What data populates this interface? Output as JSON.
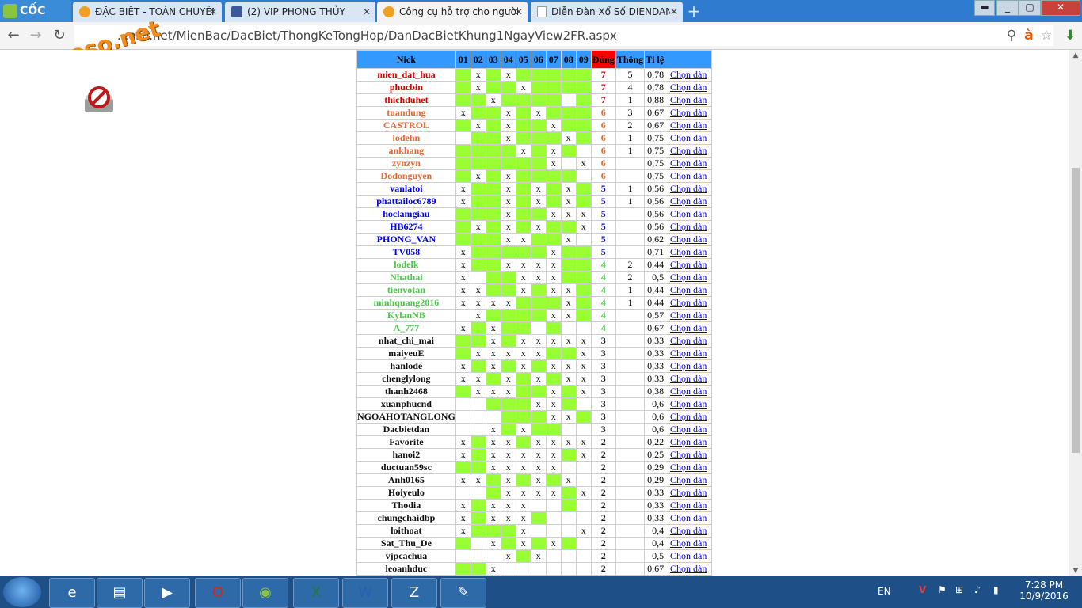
{
  "browser": {
    "logo": "CỐC CỐC",
    "tabs": [
      {
        "title": "ĐẶC BIỆT - TOÀN CHUYÊN",
        "icon": "xs-icon"
      },
      {
        "title": "(2) VIP PHONG THỦY",
        "icon": "facebook-icon"
      },
      {
        "title": "Công cụ hỗ trợ cho người",
        "icon": "xs-icon",
        "active": true
      },
      {
        "title": "Diễn Đàn Xổ Số DIENDAN",
        "icon": "page-icon"
      }
    ],
    "url": "...oso.net/MienBac/DacBiet/ThongKeTongHop/DanDacBietKhung1NgayView2FR.aspx",
    "watermark": "webxoso.net"
  },
  "table": {
    "headers": [
      "Nick",
      "01",
      "02",
      "03",
      "04",
      "05",
      "06",
      "07",
      "08",
      "09",
      "Đúng",
      "Thông",
      "Tỉ lệ",
      ""
    ],
    "link_label": "Chọn dàn",
    "rows": [
      {
        "nick": "mien_dat_hua",
        "marks": "g,x,g,x,g,g,g,g,g",
        "correct": "7",
        "streak": "5",
        "ratio": "0,78"
      },
      {
        "nick": "phucbin",
        "marks": "g,x,g,g,x,g,g,g,g",
        "correct": "7",
        "streak": "4",
        "ratio": "0,78"
      },
      {
        "nick": "thichduhet",
        "marks": "g,g,x,g,g,g,g,_,g",
        "correct": "7",
        "streak": "1",
        "ratio": "0,88"
      },
      {
        "nick": "tuandung",
        "marks": "x,g,g,x,g,x,g,g,g",
        "correct": "6",
        "streak": "3",
        "ratio": "0,67"
      },
      {
        "nick": "CASTROL",
        "marks": "g,x,g,x,g,g,x,g,g",
        "correct": "6",
        "streak": "2",
        "ratio": "0,67"
      },
      {
        "nick": "lodehn",
        "marks": "_,g,g,x,g,g,g,x,g",
        "correct": "6",
        "streak": "1",
        "ratio": "0,75"
      },
      {
        "nick": "ankhang",
        "marks": "g,g,g,g,x,g,x,g,_",
        "correct": "6",
        "streak": "1",
        "ratio": "0,75"
      },
      {
        "nick": "zynzyn",
        "marks": "g,g,g,g,g,g,x,_,x",
        "correct": "6",
        "streak": "",
        "ratio": "0,75"
      },
      {
        "nick": "Dodonguyen",
        "marks": "g,x,g,x,g,g,g,g,_",
        "correct": "6",
        "streak": "",
        "ratio": "0,75"
      },
      {
        "nick": "vanlatoi",
        "marks": "x,g,g,x,g,x,g,x,g",
        "correct": "5",
        "streak": "1",
        "ratio": "0,56"
      },
      {
        "nick": "phattailoc6789",
        "marks": "x,g,g,x,g,x,g,x,g",
        "correct": "5",
        "streak": "1",
        "ratio": "0,56"
      },
      {
        "nick": "hoclamgiau",
        "marks": "g,g,g,x,g,g,x,x,x",
        "correct": "5",
        "streak": "",
        "ratio": "0,56"
      },
      {
        "nick": "HB6274",
        "marks": "g,x,g,x,g,x,g,g,x",
        "correct": "5",
        "streak": "",
        "ratio": "0,56"
      },
      {
        "nick": "PHONG_VAN",
        "marks": "g,g,g,x,x,g,g,x,_",
        "correct": "5",
        "streak": "",
        "ratio": "0,62"
      },
      {
        "nick": "TV058",
        "marks": "x,g,g,g,g,g,x,g,g",
        "correct": "5",
        "streak": "",
        "ratio": "0,71"
      },
      {
        "nick": "lodelk",
        "marks": "x,g,g,x,x,x,x,g,g",
        "correct": "4",
        "streak": "2",
        "ratio": "0,44"
      },
      {
        "nick": "Nhathai",
        "marks": "x,_,g,g,x,x,x,g,g",
        "correct": "4",
        "streak": "2",
        "ratio": "0,5"
      },
      {
        "nick": "tienvotan",
        "marks": "x,x,g,g,x,g,x,x,g",
        "correct": "4",
        "streak": "1",
        "ratio": "0,44"
      },
      {
        "nick": "minhquang2016",
        "marks": "x,x,x,x,g,g,g,x,g",
        "correct": "4",
        "streak": "1",
        "ratio": "0,44"
      },
      {
        "nick": "KylanNB",
        "marks": "_,x,g,g,g,g,x,x,g",
        "correct": "4",
        "streak": "",
        "ratio": "0,57"
      },
      {
        "nick": "A_777",
        "marks": "x,g,x,g,g,_,g,_,_",
        "correct": "4",
        "streak": "",
        "ratio": "0,67"
      },
      {
        "nick": "nhat_chi_mai",
        "marks": "g,g,x,g,x,x,x,x,x",
        "correct": "3",
        "streak": "",
        "ratio": "0,33"
      },
      {
        "nick": "maiyeuE",
        "marks": "g,x,x,x,x,x,g,g,x",
        "correct": "3",
        "streak": "",
        "ratio": "0,33"
      },
      {
        "nick": "hanlode",
        "marks": "x,g,x,g,x,g,x,x,x",
        "correct": "3",
        "streak": "",
        "ratio": "0,33"
      },
      {
        "nick": "chenglylong",
        "marks": "x,x,g,x,g,x,g,x,x",
        "correct": "3",
        "streak": "",
        "ratio": "0,33"
      },
      {
        "nick": "thanh2468",
        "marks": "g,x,x,x,g,g,x,g,x",
        "correct": "3",
        "streak": "",
        "ratio": "0,38"
      },
      {
        "nick": "xuanphucnd",
        "marks": "_,_,g,g,g,x,x,g,_",
        "correct": "3",
        "streak": "",
        "ratio": "0,6"
      },
      {
        "nick": "NGOAHOTANGLONG",
        "marks": "_,_,_,g,g,g,x,x,g",
        "correct": "3",
        "streak": "",
        "ratio": "0,6"
      },
      {
        "nick": "Dacbietdan",
        "marks": "_,_,x,g,x,g,g,_,_",
        "correct": "3",
        "streak": "",
        "ratio": "0,6"
      },
      {
        "nick": "Favorite",
        "marks": "x,g,x,x,g,x,x,x,x",
        "correct": "2",
        "streak": "",
        "ratio": "0,22"
      },
      {
        "nick": "hanoi2",
        "marks": "x,g,x,x,x,x,x,g,x",
        "correct": "2",
        "streak": "",
        "ratio": "0,25"
      },
      {
        "nick": "ductuan59sc",
        "marks": "g,g,x,x,x,x,x,_,_",
        "correct": "2",
        "streak": "",
        "ratio": "0,29"
      },
      {
        "nick": "Anh0165",
        "marks": "x,x,g,x,g,x,g,x,_",
        "correct": "2",
        "streak": "",
        "ratio": "0,29"
      },
      {
        "nick": "Hoiyeulo",
        "marks": "_,_,g,x,x,x,x,g,x",
        "correct": "2",
        "streak": "",
        "ratio": "0,33"
      },
      {
        "nick": "Thodia",
        "marks": "x,g,x,x,x,_,_,g,_",
        "correct": "2",
        "streak": "",
        "ratio": "0,33"
      },
      {
        "nick": "chungchaidbp",
        "marks": "x,g,x,x,x,g,_,_,_",
        "correct": "2",
        "streak": "",
        "ratio": "0,33"
      },
      {
        "nick": "loithoat",
        "marks": "x,g,g,g,x,_,_,_,x",
        "correct": "2",
        "streak": "",
        "ratio": "0,4"
      },
      {
        "nick": "Sat_Thu_De",
        "marks": "g,_,x,g,x,g,x,g,_",
        "correct": "2",
        "streak": "",
        "ratio": "0,4"
      },
      {
        "nick": "vjpcachua",
        "marks": "_,_,_,x,g,x,_,_,_",
        "correct": "2",
        "streak": "",
        "ratio": "0,5"
      },
      {
        "nick": "leoanhduc",
        "marks": "g,g,x,_,_,_,_,_,_",
        "correct": "2",
        "streak": "",
        "ratio": "0,67"
      }
    ]
  },
  "taskbar": {
    "language": "EN",
    "time": "7:28 PM",
    "date": "10/9/2016"
  }
}
